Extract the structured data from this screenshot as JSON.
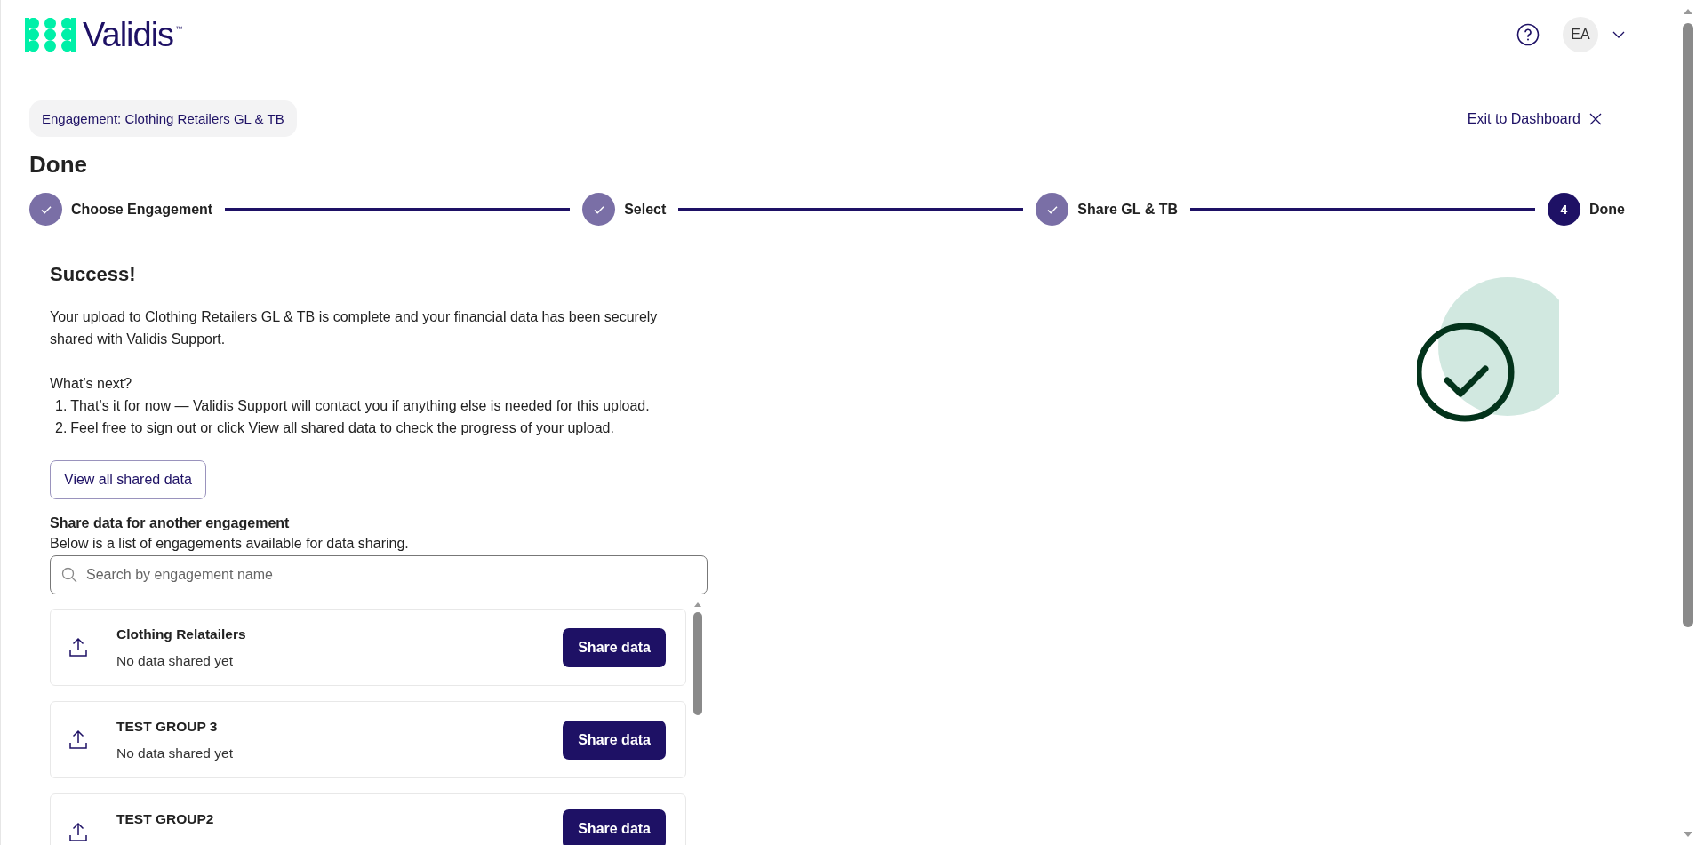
{
  "header": {
    "logo": {
      "name": "Validis",
      "trademark": "™"
    },
    "avatar": "EA"
  },
  "engagement_pill": "Engagement: Clothing Retailers GL & TB",
  "exit_link": "Exit to Dashboard",
  "title": "Done",
  "steps": [
    {
      "label": "Choose Engagement",
      "completed": true
    },
    {
      "label": "Select",
      "completed": true
    },
    {
      "label": "Share GL & TB",
      "completed": true
    },
    {
      "label": "Done",
      "completed": false,
      "number": "4"
    }
  ],
  "success": {
    "heading": "Success!",
    "message": "Your upload to Clothing Retailers GL & TB is complete and your financial data has been securely shared with Validis Support.",
    "next_heading": "What’s next?",
    "next_steps": [
      {
        "number": "1.",
        "text": "That’s it for now — Validis Support will contact you if anything else is needed for this upload."
      },
      {
        "number": "2.",
        "text": "Feel free to sign out or click View all shared data to check the progress of your upload."
      }
    ],
    "button": "View all shared data"
  },
  "share_section": {
    "heading": "Share data for another engagement",
    "description": "Below is a list of engagements available for data sharing.",
    "search": {
      "placeholder": "Search by engagement name"
    },
    "engagements": [
      {
        "name": "Clothing Relatailers",
        "status": "No data shared yet",
        "button": "Share data"
      },
      {
        "name": "TEST GROUP 3",
        "status": "No data shared yet",
        "button": "Share data"
      },
      {
        "name": "TEST GROUP2",
        "button": "Share data"
      }
    ]
  }
}
